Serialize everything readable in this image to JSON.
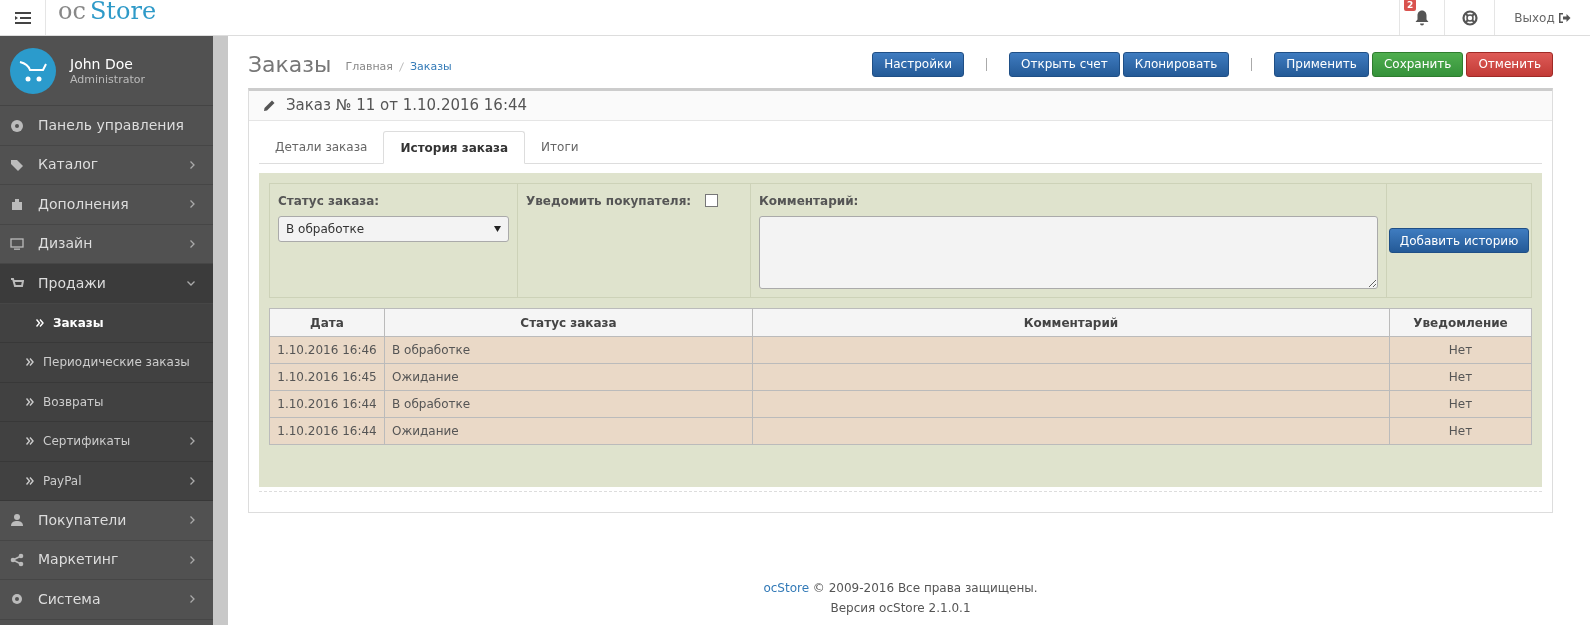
{
  "header": {
    "logo": {
      "prefix": "oc",
      "name": "Store"
    },
    "notification_count": "2",
    "logout": "Выход"
  },
  "user": {
    "name": "John Doe",
    "role": "Administrator"
  },
  "sidebar": {
    "items": [
      {
        "label": "Панель управления",
        "has_submenu": false,
        "expanded": false
      },
      {
        "label": "Каталог",
        "has_submenu": true,
        "expanded": false
      },
      {
        "label": "Дополнения",
        "has_submenu": true,
        "expanded": false
      },
      {
        "label": "Дизайн",
        "has_submenu": true,
        "expanded": false
      },
      {
        "label": "Продажи",
        "has_submenu": true,
        "expanded": true,
        "children": [
          {
            "label": "Заказы",
            "selected": true,
            "has_submenu": false
          },
          {
            "label": "Периодические заказы",
            "selected": false,
            "has_submenu": false
          },
          {
            "label": "Возвраты",
            "selected": false,
            "has_submenu": false
          },
          {
            "label": "Сертификаты",
            "selected": false,
            "has_submenu": true
          },
          {
            "label": "PayPal",
            "selected": false,
            "has_submenu": true
          }
        ]
      },
      {
        "label": "Покупатели",
        "has_submenu": true,
        "expanded": false
      },
      {
        "label": "Маркетинг",
        "has_submenu": true,
        "expanded": false
      },
      {
        "label": "Система",
        "has_submenu": true,
        "expanded": false
      }
    ]
  },
  "page": {
    "title": "Заказы",
    "breadcrumbs": [
      {
        "label": "Главная",
        "kind": "home"
      },
      {
        "label": "Заказы",
        "kind": "link"
      }
    ],
    "toolbar": [
      [
        {
          "label": "Настройки",
          "kind": "primary"
        }
      ],
      [
        {
          "label": "Открыть счет",
          "kind": "primary"
        },
        {
          "label": "Клонировать",
          "kind": "primary"
        }
      ],
      [
        {
          "label": "Применить",
          "kind": "primary"
        },
        {
          "label": "Сохранить",
          "kind": "success"
        },
        {
          "label": "Отменить",
          "kind": "danger"
        }
      ]
    ]
  },
  "panel": {
    "title": "Заказ № 11 от 1.10.2016 16:44",
    "tabs": [
      {
        "label": "Детали заказа",
        "selected": false
      },
      {
        "label": "История заказа",
        "selected": true
      },
      {
        "label": "Итоги",
        "selected": false
      }
    ],
    "form": {
      "status_label": "Статус заказа:",
      "status_value": "В обработке",
      "notify_label": "Уведомить покупателя:",
      "notify_checked": false,
      "comment_label": "Комментарий:",
      "add_button": "Добавить историю"
    },
    "table": {
      "columns": [
        "Дата",
        "Статус заказа",
        "Комментарий",
        "Уведомление"
      ],
      "rows": [
        [
          "1.10.2016 16:46",
          "В обработке",
          "",
          "Нет"
        ],
        [
          "1.10.2016 16:45",
          "Ожидание",
          "",
          "Нет"
        ],
        [
          "1.10.2016 16:44",
          "В обработке",
          "",
          "Нет"
        ],
        [
          "1.10.2016 16:44",
          "Ожидание",
          "",
          "Нет"
        ]
      ]
    }
  },
  "footer": {
    "brand": "ocStore",
    "copyright": "© 2009-2016 Все права защищены.",
    "version": "Версия ocStore 2.1.0.1"
  }
}
